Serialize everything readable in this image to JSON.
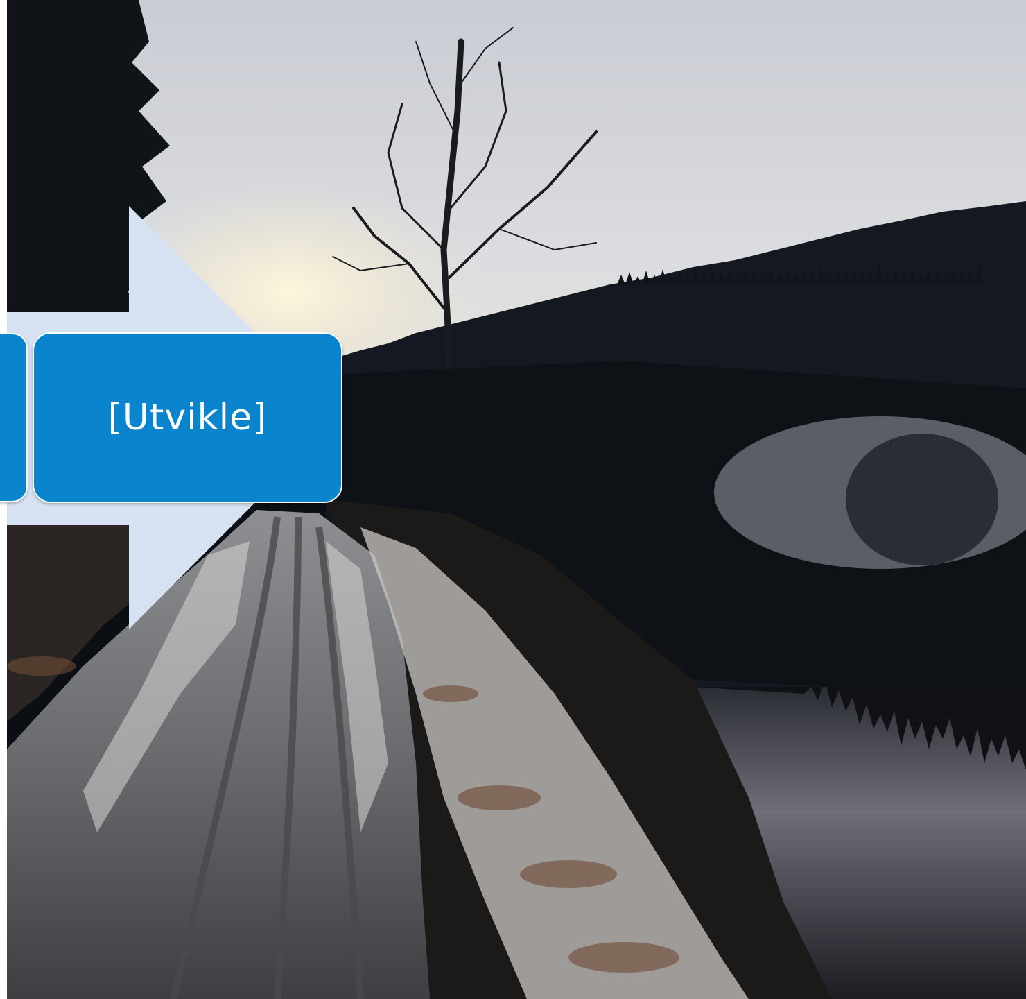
{
  "process": {
    "steps": [
      {
        "label": ""
      },
      {
        "label": "[Utvikle]"
      }
    ]
  },
  "colors": {
    "box_fill": "#0a84cc",
    "arrow_fill": "#d6e2f2",
    "box_text": "#ffffff"
  }
}
